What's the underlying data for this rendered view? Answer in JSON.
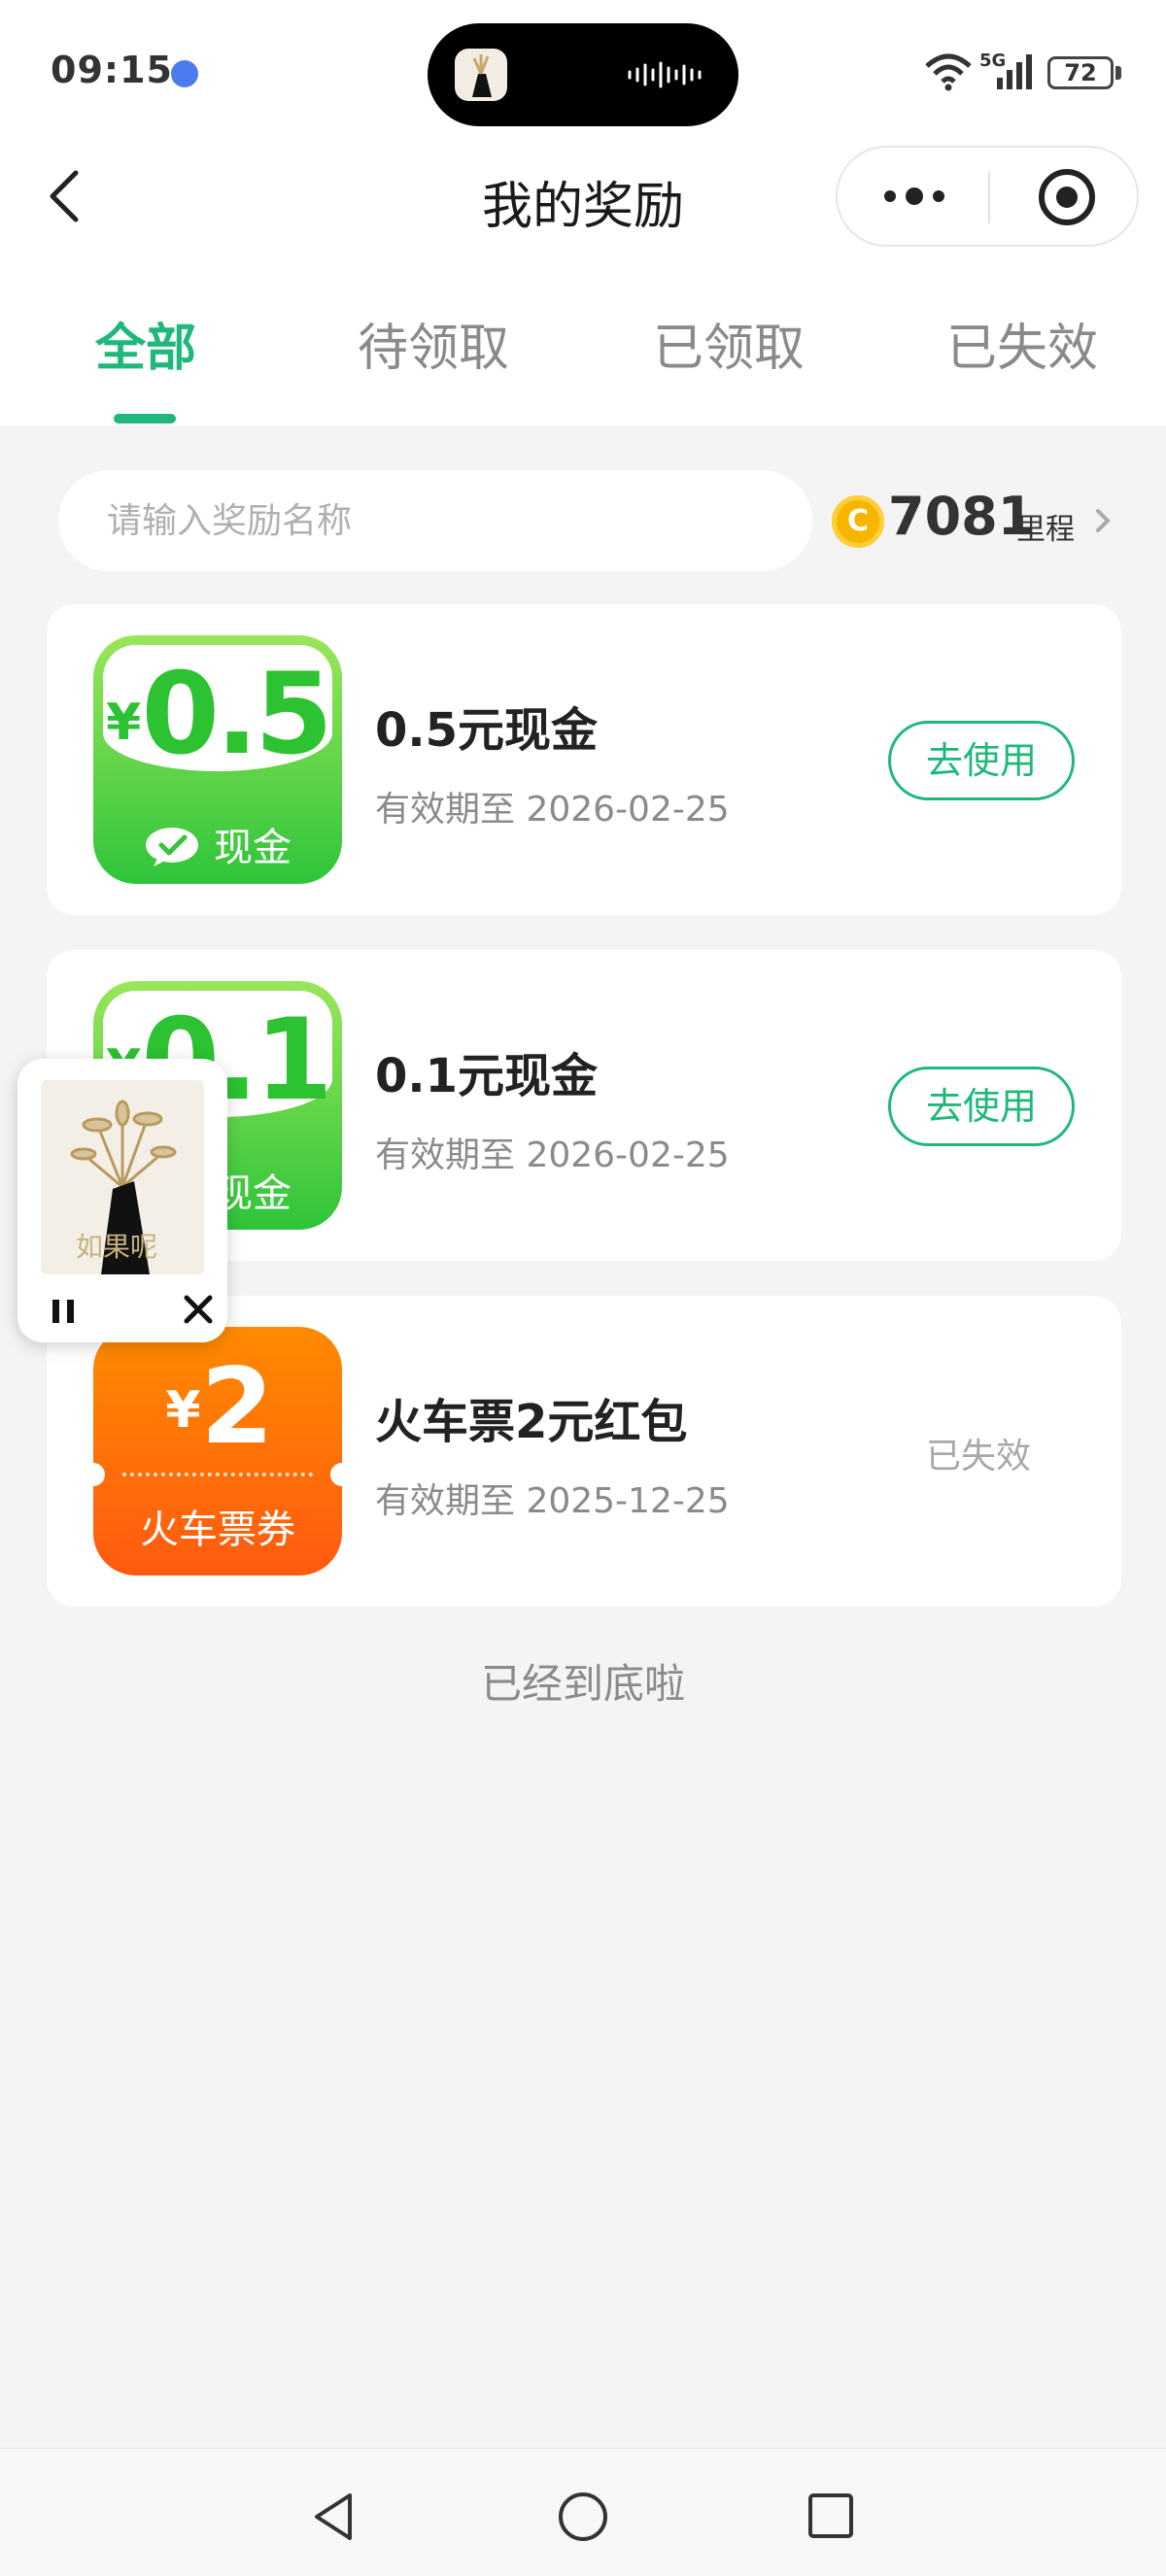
{
  "status_bar": {
    "time": "09:15",
    "network": "5G",
    "battery": "72"
  },
  "nav": {
    "title": "我的奖励"
  },
  "tabs": [
    {
      "label": "全部",
      "active": true
    },
    {
      "label": "待领取",
      "active": false
    },
    {
      "label": "已领取",
      "active": false
    },
    {
      "label": "已失效",
      "active": false
    }
  ],
  "search": {
    "placeholder": "请输入奖励名称",
    "value": ""
  },
  "mileage": {
    "coin_glyph": "C",
    "value": "7081",
    "unit": "里程"
  },
  "rewards": [
    {
      "currency": "¥",
      "amount": "0.5",
      "badge_label": "现金",
      "title": "0.5元现金",
      "expiry": "有效期至 2026-02-25",
      "action": "去使用",
      "badge_color": "#2fc43a"
    },
    {
      "currency": "¥",
      "amount": "0.1",
      "badge_label": "现金",
      "title": "0.1元现金",
      "expiry": "有效期至 2026-02-25",
      "action": "去使用",
      "badge_color": "#2fc43a"
    },
    {
      "currency": "¥",
      "amount": "2",
      "badge_label": "火车票券",
      "title": "火车票2元红包",
      "expiry": "有效期至 2025-12-25",
      "status": "已失效",
      "badge_color": "#ff6a0a"
    }
  ],
  "footer": {
    "end_text": "已经到底啦"
  },
  "mini_player": {
    "art_text": "如果呢"
  },
  "colors": {
    "accent": "#1fb87a",
    "cash_green": "#2cc231",
    "train_orange": "#ff6a0a"
  }
}
